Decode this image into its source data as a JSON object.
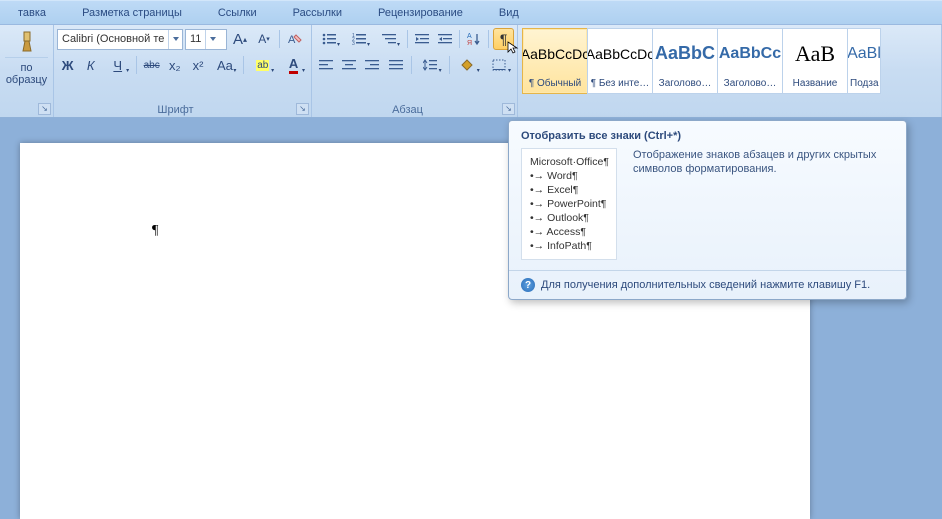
{
  "tabs": [
    "тавка",
    "Разметка страницы",
    "Ссылки",
    "Рассылки",
    "Рецензирование",
    "Вид"
  ],
  "clipboard": {
    "label1": "по",
    "label2": "образцу"
  },
  "font": {
    "group_label": "Шрифт",
    "name": "Calibri (Основной те",
    "size": "11",
    "grow": "A",
    "shrink": "A",
    "bold": "Ж",
    "italic": "К",
    "under": "Ч",
    "strike": "abc",
    "sub": "x₂",
    "sup": "x²",
    "case": "Aa",
    "highlight": "ab",
    "color": "A"
  },
  "para": {
    "group_label": "Абзац",
    "pilcrow": "¶"
  },
  "styles": [
    {
      "preview": "AaBbCcDc",
      "name": "¶ Обычный",
      "color": "#000",
      "size": "14px",
      "sel": true
    },
    {
      "preview": "AaBbCcDc",
      "name": "¶ Без инте…",
      "color": "#000",
      "size": "14px"
    },
    {
      "preview": "AaBbC",
      "name": "Заголово…",
      "color": "#356aa8",
      "size": "18px",
      "weight": "bold"
    },
    {
      "preview": "AaBbCc",
      "name": "Заголово…",
      "color": "#356aa8",
      "size": "16px",
      "weight": "bold"
    },
    {
      "preview": "АаВ",
      "name": "Название",
      "color": "#000",
      "size": "22px",
      "serif": true
    },
    {
      "preview": "AaBl",
      "name": "Подза",
      "color": "#356aa8",
      "size": "16px",
      "partial": true
    }
  ],
  "doc": {
    "content": "¶"
  },
  "tooltip": {
    "title": "Отобразить все знаки (Ctrl+*)",
    "sample_head": "Microsoft·Office¶",
    "sample_items": [
      "Word¶",
      "Excel¶",
      "PowerPoint¶",
      "Outlook¶",
      "Access¶",
      "InfoPath¶"
    ],
    "desc": "Отображение знаков абзацев и других скрытых символов форматирования.",
    "footer": "Для получения дополнительных сведений нажмите клавишу F1."
  }
}
